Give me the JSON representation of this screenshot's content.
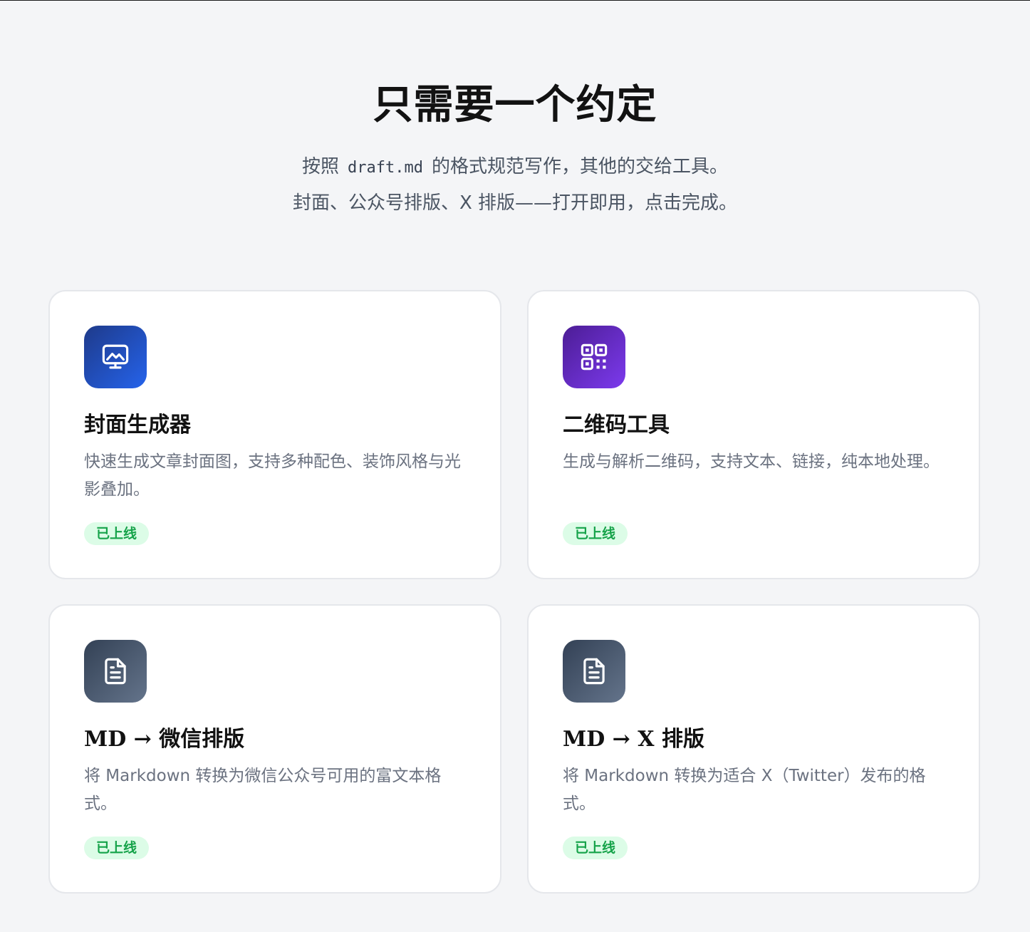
{
  "hero": {
    "title": "只需要一个约定",
    "line1_before": "按照",
    "line1_code": "draft.md",
    "line1_after": "的格式规范写作，其他的交给工具。",
    "line2": "封面、公众号排版、X 排版——打开即用，点击完成。"
  },
  "cards": [
    {
      "icon": "monitor-image-icon",
      "icon_color": "#2563eb",
      "title": "封面生成器",
      "description": "快速生成文章封面图，支持多种配色、装饰风格与光影叠加。",
      "status": "已上线"
    },
    {
      "icon": "qr-code-icon",
      "icon_color": "#7c3aed",
      "title": "二维码工具",
      "description": "生成与解析二维码，支持文本、链接，纯本地处理。",
      "status": "已上线"
    },
    {
      "icon": "document-icon",
      "icon_color": "#475569",
      "title": "MD → 微信排版",
      "description": "将 Markdown 转换为微信公众号可用的富文本格式。",
      "status": "已上线"
    },
    {
      "icon": "document-icon",
      "icon_color": "#475569",
      "title": "MD → X 排版",
      "description": "将 Markdown 转换为适合 X（Twitter）发布的格式。",
      "status": "已上线"
    }
  ],
  "colors": {
    "background": "#f4f5f7",
    "badge_bg": "#dcfce7",
    "badge_text": "#16a34a"
  }
}
